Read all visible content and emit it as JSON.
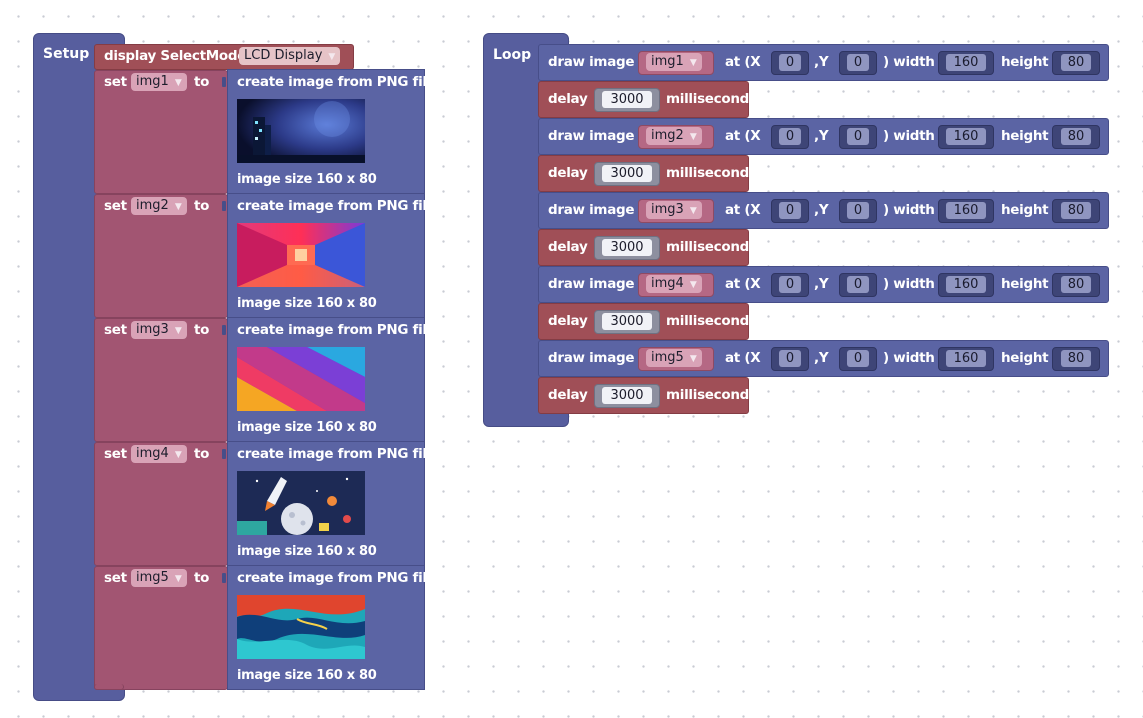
{
  "setup": {
    "label": "Setup",
    "display_label": "display SelectMode",
    "display_mode": "LCD Display",
    "variables": [
      {
        "set": "set",
        "var": "img1",
        "to": "to",
        "create": "create image from PNG file",
        "size": "image size 160 x 80",
        "thumb": "night-city"
      },
      {
        "set": "set",
        "var": "img2",
        "to": "to",
        "create": "create image from PNG file",
        "size": "image size 160 x 80",
        "thumb": "neon-corridor"
      },
      {
        "set": "set",
        "var": "img3",
        "to": "to",
        "create": "create image from PNG file",
        "size": "image size 160 x 80",
        "thumb": "color-stripes"
      },
      {
        "set": "set",
        "var": "img4",
        "to": "to",
        "create": "create image from PNG file",
        "size": "image size 160 x 80",
        "thumb": "astronaut-moon"
      },
      {
        "set": "set",
        "var": "img5",
        "to": "to",
        "create": "create image from PNG file",
        "size": "image size 160 x 80",
        "thumb": "fluid-art"
      }
    ]
  },
  "loop": {
    "label": "Loop",
    "steps": [
      {
        "draw": "draw image",
        "img": "img1",
        "at": "at (X",
        "x": "0",
        "ycomma": ",Y",
        "y": "0",
        "width_label": ") width",
        "width": "160",
        "height_label": "height",
        "height": "80",
        "delay": "delay",
        "ms": "3000",
        "unit": "millisecond"
      },
      {
        "draw": "draw image",
        "img": "img2",
        "at": "at (X",
        "x": "0",
        "ycomma": ",Y",
        "y": "0",
        "width_label": ") width",
        "width": "160",
        "height_label": "height",
        "height": "80",
        "delay": "delay",
        "ms": "3000",
        "unit": "millisecond"
      },
      {
        "draw": "draw image",
        "img": "img3",
        "at": "at (X",
        "x": "0",
        "ycomma": ",Y",
        "y": "0",
        "width_label": ") width",
        "width": "160",
        "height_label": "height",
        "height": "80",
        "delay": "delay",
        "ms": "3000",
        "unit": "millisecond"
      },
      {
        "draw": "draw image",
        "img": "img4",
        "at": "at (X",
        "x": "0",
        "ycomma": ",Y",
        "y": "0",
        "width_label": ") width",
        "width": "160",
        "height_label": "height",
        "height": "80",
        "delay": "delay",
        "ms": "3000",
        "unit": "millisecond"
      },
      {
        "draw": "draw image",
        "img": "img5",
        "at": "at (X",
        "x": "0",
        "ycomma": ",Y",
        "y": "0",
        "width_label": ") width",
        "width": "160",
        "height_label": "height",
        "height": "80",
        "delay": "delay",
        "ms": "3000",
        "unit": "millisecond"
      }
    ]
  },
  "colors": {
    "hat": "#575e9e",
    "variable": "#a25572",
    "image_block": "#5b64a4",
    "delay_block": "#a04f57"
  }
}
